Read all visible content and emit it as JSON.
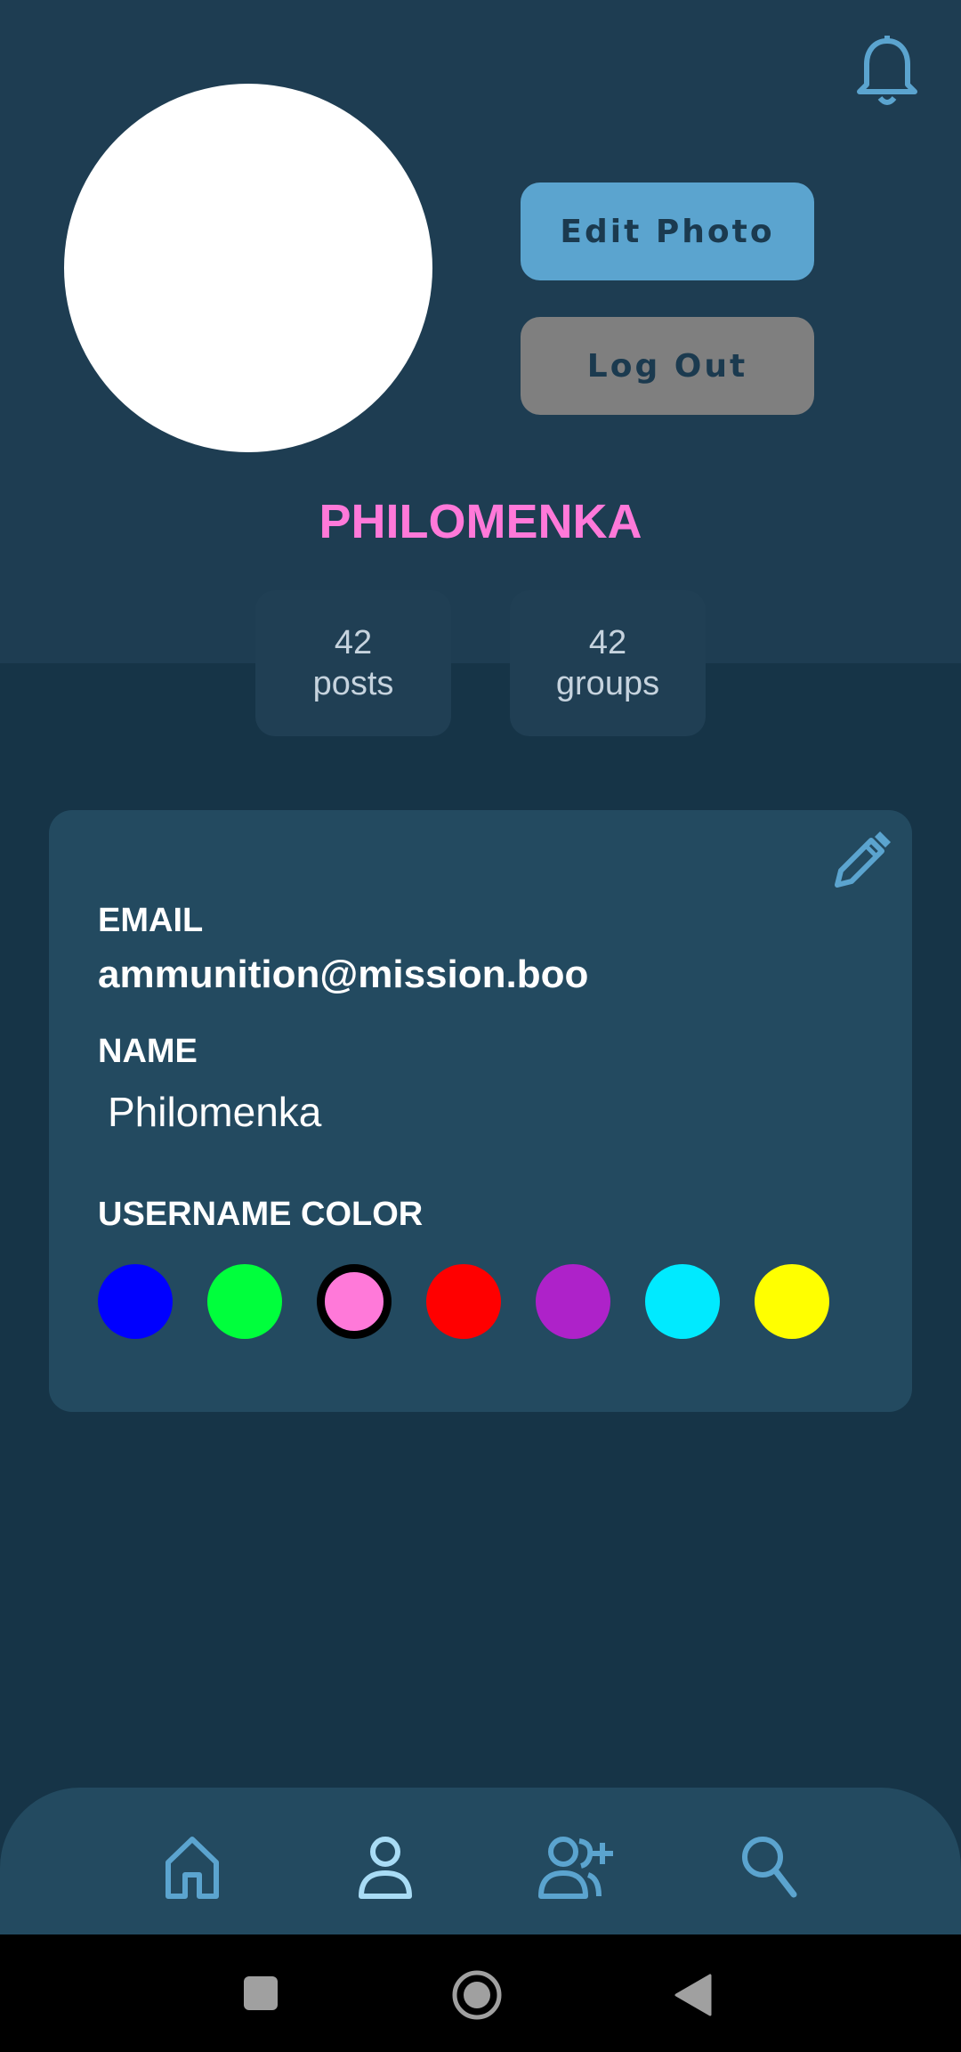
{
  "header": {
    "notifications_icon": "bell-icon",
    "edit_photo_label": "Edit Photo",
    "logout_label": "Log Out"
  },
  "profile": {
    "username": "PHILOMENKA",
    "username_color": "#ff79d9",
    "stats": {
      "posts_count": "42",
      "posts_label": "posts",
      "groups_count": "42",
      "groups_label": "groups"
    }
  },
  "details": {
    "edit_icon": "pencil-icon",
    "email_label": "EMAIL",
    "email_value": "ammunition@mission.boo",
    "name_label": "NAME",
    "name_value": "Philomenka",
    "color_label": "USERNAME COLOR",
    "color_options": [
      "#0000ff",
      "#00ff3c",
      "#ff79d9",
      "#ff0000",
      "#ae22c9",
      "#00eaff",
      "#ffff00"
    ],
    "selected_color": "#ff79d9"
  },
  "bottom_nav": {
    "items": [
      {
        "icon": "home-icon"
      },
      {
        "icon": "profile-icon"
      },
      {
        "icon": "add-friend-icon"
      },
      {
        "icon": "search-icon"
      }
    ]
  },
  "system_nav": {
    "items": [
      "recents-button",
      "home-button",
      "back-button"
    ]
  },
  "colors": {
    "background": "#163447",
    "header_background": "#1e3d52",
    "card_background": "#234a60",
    "accent": "#5ba4cf"
  }
}
